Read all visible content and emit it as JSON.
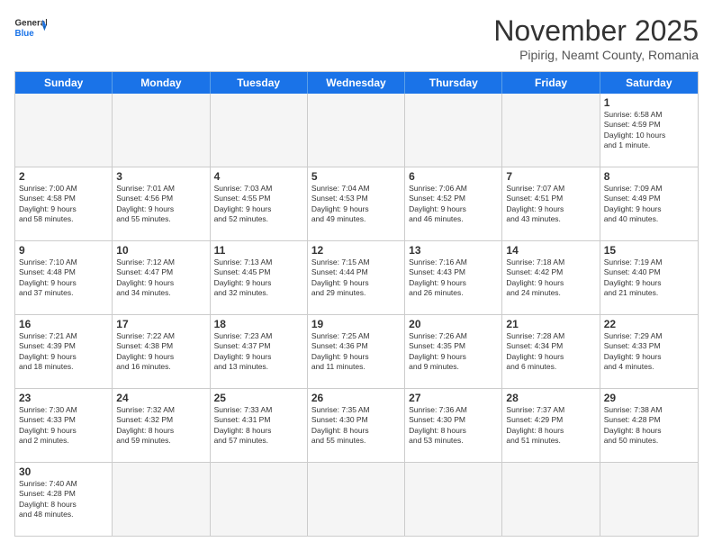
{
  "header": {
    "logo_general": "General",
    "logo_blue": "Blue",
    "month": "November 2025",
    "location": "Pipirig, Neamt County, Romania"
  },
  "weekdays": [
    "Sunday",
    "Monday",
    "Tuesday",
    "Wednesday",
    "Thursday",
    "Friday",
    "Saturday"
  ],
  "rows": [
    [
      {
        "day": "",
        "info": "",
        "empty": true
      },
      {
        "day": "",
        "info": "",
        "empty": true
      },
      {
        "day": "",
        "info": "",
        "empty": true
      },
      {
        "day": "",
        "info": "",
        "empty": true
      },
      {
        "day": "",
        "info": "",
        "empty": true
      },
      {
        "day": "",
        "info": "",
        "empty": true
      },
      {
        "day": "1",
        "info": "Sunrise: 6:58 AM\nSunset: 4:59 PM\nDaylight: 10 hours\nand 1 minute.",
        "empty": false
      }
    ],
    [
      {
        "day": "2",
        "info": "Sunrise: 7:00 AM\nSunset: 4:58 PM\nDaylight: 9 hours\nand 58 minutes.",
        "empty": false
      },
      {
        "day": "3",
        "info": "Sunrise: 7:01 AM\nSunset: 4:56 PM\nDaylight: 9 hours\nand 55 minutes.",
        "empty": false
      },
      {
        "day": "4",
        "info": "Sunrise: 7:03 AM\nSunset: 4:55 PM\nDaylight: 9 hours\nand 52 minutes.",
        "empty": false
      },
      {
        "day": "5",
        "info": "Sunrise: 7:04 AM\nSunset: 4:53 PM\nDaylight: 9 hours\nand 49 minutes.",
        "empty": false
      },
      {
        "day": "6",
        "info": "Sunrise: 7:06 AM\nSunset: 4:52 PM\nDaylight: 9 hours\nand 46 minutes.",
        "empty": false
      },
      {
        "day": "7",
        "info": "Sunrise: 7:07 AM\nSunset: 4:51 PM\nDaylight: 9 hours\nand 43 minutes.",
        "empty": false
      },
      {
        "day": "8",
        "info": "Sunrise: 7:09 AM\nSunset: 4:49 PM\nDaylight: 9 hours\nand 40 minutes.",
        "empty": false
      }
    ],
    [
      {
        "day": "9",
        "info": "Sunrise: 7:10 AM\nSunset: 4:48 PM\nDaylight: 9 hours\nand 37 minutes.",
        "empty": false
      },
      {
        "day": "10",
        "info": "Sunrise: 7:12 AM\nSunset: 4:47 PM\nDaylight: 9 hours\nand 34 minutes.",
        "empty": false
      },
      {
        "day": "11",
        "info": "Sunrise: 7:13 AM\nSunset: 4:45 PM\nDaylight: 9 hours\nand 32 minutes.",
        "empty": false
      },
      {
        "day": "12",
        "info": "Sunrise: 7:15 AM\nSunset: 4:44 PM\nDaylight: 9 hours\nand 29 minutes.",
        "empty": false
      },
      {
        "day": "13",
        "info": "Sunrise: 7:16 AM\nSunset: 4:43 PM\nDaylight: 9 hours\nand 26 minutes.",
        "empty": false
      },
      {
        "day": "14",
        "info": "Sunrise: 7:18 AM\nSunset: 4:42 PM\nDaylight: 9 hours\nand 24 minutes.",
        "empty": false
      },
      {
        "day": "15",
        "info": "Sunrise: 7:19 AM\nSunset: 4:40 PM\nDaylight: 9 hours\nand 21 minutes.",
        "empty": false
      }
    ],
    [
      {
        "day": "16",
        "info": "Sunrise: 7:21 AM\nSunset: 4:39 PM\nDaylight: 9 hours\nand 18 minutes.",
        "empty": false
      },
      {
        "day": "17",
        "info": "Sunrise: 7:22 AM\nSunset: 4:38 PM\nDaylight: 9 hours\nand 16 minutes.",
        "empty": false
      },
      {
        "day": "18",
        "info": "Sunrise: 7:23 AM\nSunset: 4:37 PM\nDaylight: 9 hours\nand 13 minutes.",
        "empty": false
      },
      {
        "day": "19",
        "info": "Sunrise: 7:25 AM\nSunset: 4:36 PM\nDaylight: 9 hours\nand 11 minutes.",
        "empty": false
      },
      {
        "day": "20",
        "info": "Sunrise: 7:26 AM\nSunset: 4:35 PM\nDaylight: 9 hours\nand 9 minutes.",
        "empty": false
      },
      {
        "day": "21",
        "info": "Sunrise: 7:28 AM\nSunset: 4:34 PM\nDaylight: 9 hours\nand 6 minutes.",
        "empty": false
      },
      {
        "day": "22",
        "info": "Sunrise: 7:29 AM\nSunset: 4:33 PM\nDaylight: 9 hours\nand 4 minutes.",
        "empty": false
      }
    ],
    [
      {
        "day": "23",
        "info": "Sunrise: 7:30 AM\nSunset: 4:33 PM\nDaylight: 9 hours\nand 2 minutes.",
        "empty": false
      },
      {
        "day": "24",
        "info": "Sunrise: 7:32 AM\nSunset: 4:32 PM\nDaylight: 8 hours\nand 59 minutes.",
        "empty": false
      },
      {
        "day": "25",
        "info": "Sunrise: 7:33 AM\nSunset: 4:31 PM\nDaylight: 8 hours\nand 57 minutes.",
        "empty": false
      },
      {
        "day": "26",
        "info": "Sunrise: 7:35 AM\nSunset: 4:30 PM\nDaylight: 8 hours\nand 55 minutes.",
        "empty": false
      },
      {
        "day": "27",
        "info": "Sunrise: 7:36 AM\nSunset: 4:30 PM\nDaylight: 8 hours\nand 53 minutes.",
        "empty": false
      },
      {
        "day": "28",
        "info": "Sunrise: 7:37 AM\nSunset: 4:29 PM\nDaylight: 8 hours\nand 51 minutes.",
        "empty": false
      },
      {
        "day": "29",
        "info": "Sunrise: 7:38 AM\nSunset: 4:28 PM\nDaylight: 8 hours\nand 50 minutes.",
        "empty": false
      }
    ],
    [
      {
        "day": "30",
        "info": "Sunrise: 7:40 AM\nSunset: 4:28 PM\nDaylight: 8 hours\nand 48 minutes.",
        "empty": false
      },
      {
        "day": "",
        "info": "",
        "empty": true
      },
      {
        "day": "",
        "info": "",
        "empty": true
      },
      {
        "day": "",
        "info": "",
        "empty": true
      },
      {
        "day": "",
        "info": "",
        "empty": true
      },
      {
        "day": "",
        "info": "",
        "empty": true
      },
      {
        "day": "",
        "info": "",
        "empty": true
      }
    ]
  ]
}
